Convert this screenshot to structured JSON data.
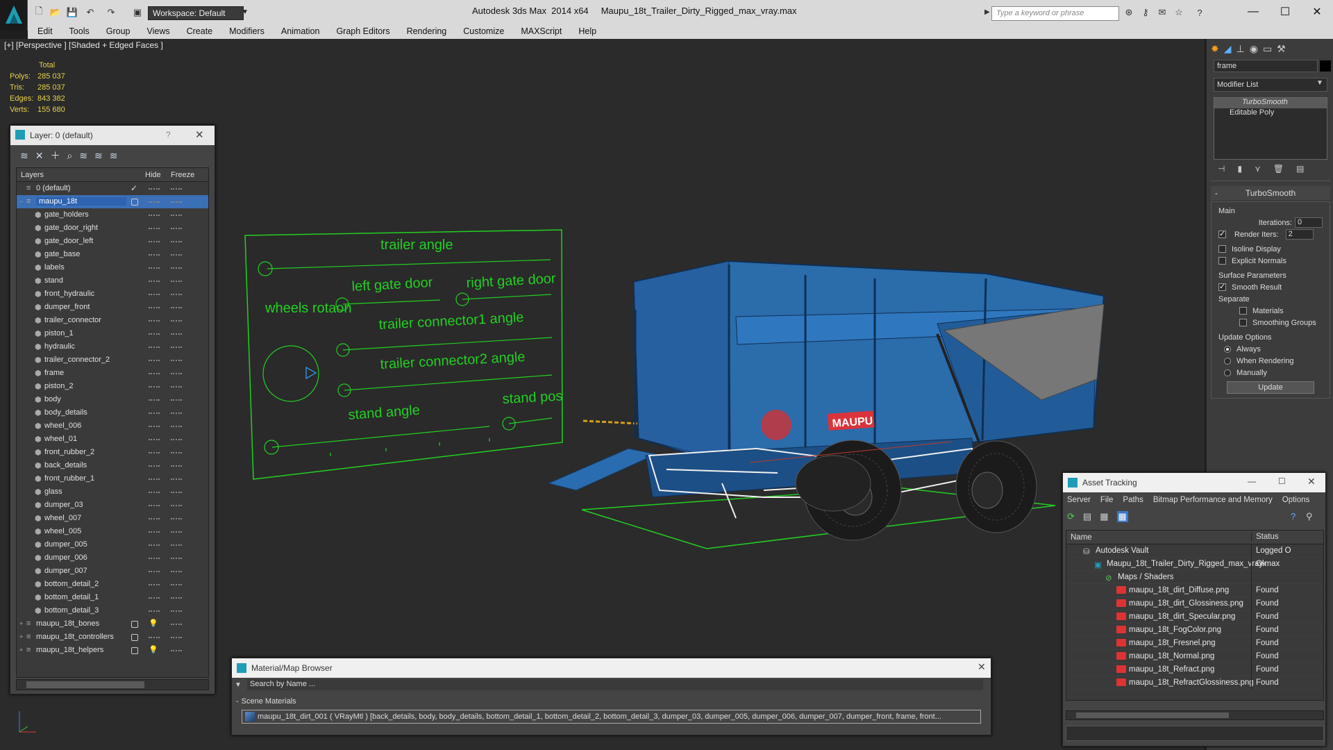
{
  "app": {
    "title": "Autodesk 3ds Max  2014 x64     Maupu_18t_Trailer_Dirty_Rigged_max_vray.max",
    "workspace": "Workspace: Default",
    "search_placeholder": "Type a keyword or phrase"
  },
  "menu": [
    "Edit",
    "Tools",
    "Group",
    "Views",
    "Create",
    "Modifiers",
    "Animation",
    "Graph Editors",
    "Rendering",
    "Customize",
    "MAXScript",
    "Help"
  ],
  "viewport": {
    "label": "[+] [Perspective ] [Shaded + Edged Faces ]",
    "stats": {
      "header": "Total",
      "rows": [
        {
          "k": "Polys:",
          "v": "285 037"
        },
        {
          "k": "Tris:",
          "v": "285 037"
        },
        {
          "k": "Edges:",
          "v": "843 382"
        },
        {
          "k": "Verts:",
          "v": "155 680"
        }
      ]
    },
    "rig_panel": {
      "labels": [
        "trailer angle",
        "left gate door",
        "right gate door",
        "wheels rotaon",
        "trailer connector1 angle",
        "trailer connector2 angle",
        "stand angle",
        "stand pos"
      ]
    },
    "trailer_brand": "MAUPU"
  },
  "layer_dialog": {
    "title": "Layer: 0 (default)",
    "help": "?",
    "columns": {
      "layers": "Layers",
      "hide": "Hide",
      "freeze": "Freeze"
    },
    "top_layers": [
      {
        "name": "0 (default)"
      },
      {
        "name": "maupu_18t"
      }
    ],
    "children": [
      "gate_holders",
      "gate_door_right",
      "gate_door_left",
      "gate_base",
      "labels",
      "stand",
      "front_hydraulic",
      "dumper_front",
      "trailer_connector",
      "piston_1",
      "hydraulic",
      "trailer_connector_2",
      "frame",
      "piston_2",
      "body",
      "body_details",
      "wheel_006",
      "wheel_01",
      "front_rubber_2",
      "back_details",
      "front_rubber_1",
      "glass",
      "dumper_03",
      "wheel_007",
      "wheel_005",
      "dumper_005",
      "dumper_006",
      "dumper_007",
      "bottom_detail_2",
      "bottom_detail_1",
      "bottom_detail_3"
    ],
    "bottom_layers": [
      {
        "name": "maupu_18t_bones"
      },
      {
        "name": "maupu_18t_controllers"
      },
      {
        "name": "maupu_18t_helpers"
      }
    ]
  },
  "command_panel": {
    "object_name": "frame",
    "modifier_list": "Modifier List",
    "stack": [
      "TurboSmooth",
      "Editable Poly"
    ],
    "turbosmooth": {
      "title": "TurboSmooth",
      "main": "Main",
      "iterations_label": "Iterations:",
      "iterations": "0",
      "render_iters_label": "Render Iters:",
      "render_iters": "2",
      "isoline": "Isoline Display",
      "explicit": "Explicit Normals",
      "surface": "Surface Parameters",
      "smooth_result": "Smooth Result",
      "separate": "Separate",
      "materials": "Materials",
      "smoothing_groups": "Smoothing Groups",
      "update_options": "Update Options",
      "always": "Always",
      "when_rendering": "When Rendering",
      "manually": "Manually",
      "update": "Update"
    }
  },
  "asset_tracking": {
    "title": "Asset Tracking",
    "menu": [
      "Server",
      "File",
      "Paths",
      "Bitmap Performance and Memory",
      "Options"
    ],
    "columns": {
      "name": "Name",
      "status": "Status"
    },
    "rows": [
      {
        "name": "Autodesk Vault",
        "status": "Logged O",
        "indent": 0,
        "icon": "vault"
      },
      {
        "name": "Maupu_18t_Trailer_Dirty_Rigged_max_vray.max",
        "status": "Ok",
        "indent": 1,
        "icon": "max"
      },
      {
        "name": "Maps / Shaders",
        "status": "",
        "indent": 2,
        "icon": "maps"
      },
      {
        "name": "maupu_18t_dirt_Diffuse.png",
        "status": "Found",
        "indent": 3,
        "icon": "png"
      },
      {
        "name": "maupu_18t_dirt_Glossiness.png",
        "status": "Found",
        "indent": 3,
        "icon": "png"
      },
      {
        "name": "maupu_18t_dirt_Specular.png",
        "status": "Found",
        "indent": 3,
        "icon": "png"
      },
      {
        "name": "maupu_18t_FogColor.png",
        "status": "Found",
        "indent": 3,
        "icon": "png"
      },
      {
        "name": "maupu_18t_Fresnel.png",
        "status": "Found",
        "indent": 3,
        "icon": "png"
      },
      {
        "name": "maupu_18t_Normal.png",
        "status": "Found",
        "indent": 3,
        "icon": "png"
      },
      {
        "name": "maupu_18t_Refract.png",
        "status": "Found",
        "indent": 3,
        "icon": "png"
      },
      {
        "name": "maupu_18t_RefractGlossiness.png",
        "status": "Found",
        "indent": 3,
        "icon": "png"
      }
    ]
  },
  "material_browser": {
    "title": "Material/Map Browser",
    "search_placeholder": "Search by Name ...",
    "section": "Scene Materials",
    "entry": "maupu_18t_dirt_001  ( VRayMtl ) [back_details, body, body_details, bottom_detail_1, bottom_detail_2, bottom_detail_3, dumper_03, dumper_005, dumper_006, dumper_007, dumper_front, frame, front..."
  },
  "colors": {
    "accent_blue": "#2e6fb8",
    "rig_green": "#22d022",
    "stats_yellow": "#e8d24a",
    "trailer_blue": "#2a6cb0"
  }
}
